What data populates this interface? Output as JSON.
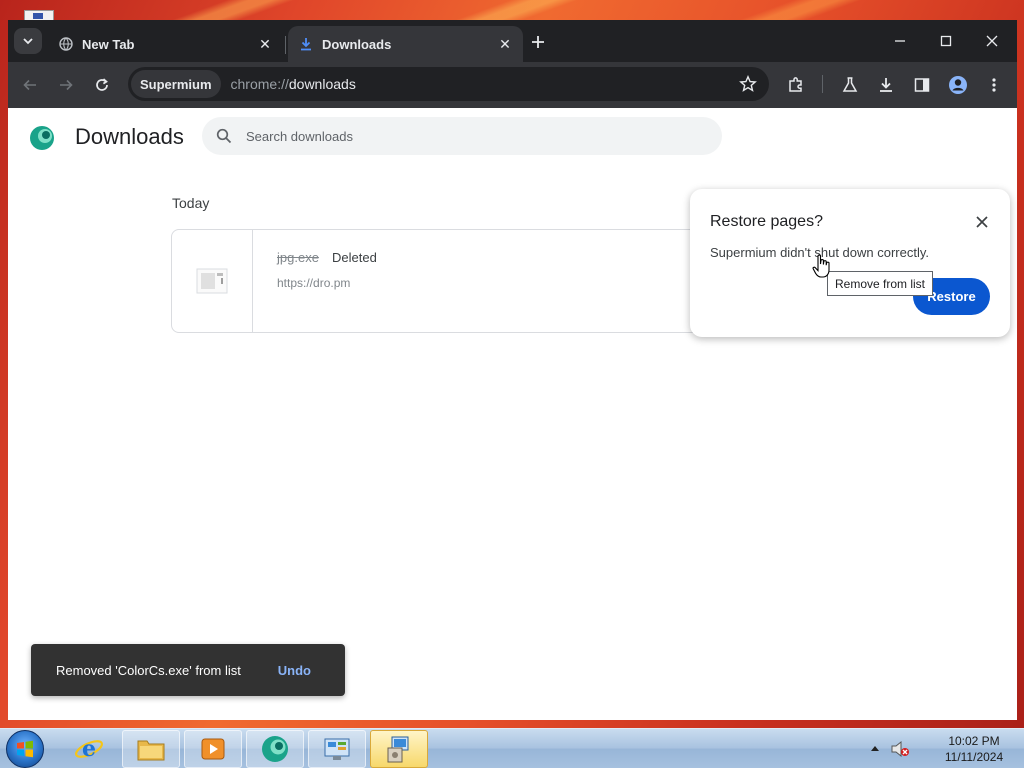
{
  "browser": {
    "tabs": [
      {
        "title": "New Tab",
        "icon": "globe-icon",
        "active": false
      },
      {
        "title": "Downloads",
        "icon": "download-icon",
        "active": true
      }
    ],
    "origin_chip": "Supermium",
    "url_scheme": "chrome://",
    "url_path": "downloads"
  },
  "downloads_page": {
    "title": "Downloads",
    "search_placeholder": "Search downloads",
    "section_label": "Today",
    "items": [
      {
        "file_name": "jpg.exe",
        "status": "Deleted",
        "url": "https://dro.pm"
      }
    ],
    "remove_tooltip": "Remove from list"
  },
  "restore_popup": {
    "title": "Restore pages?",
    "message": "Supermium didn't shut down correctly.",
    "button_label": "Restore"
  },
  "snackbar": {
    "message": "Removed 'ColorCs.exe' from list",
    "action_label": "Undo"
  },
  "taskbar": {
    "apps": [
      "internet-explorer-icon",
      "file-explorer-icon",
      "media-player-icon",
      "supermium-icon",
      "control-panel-icon",
      "installer-icon"
    ],
    "time": "10:02 PM",
    "date": "11/11/2024"
  },
  "colors": {
    "accent_button": "#0b57d0",
    "snackbar_action": "#8ab4f8",
    "toolbar": "#35363a",
    "tabstrip": "#202124"
  }
}
